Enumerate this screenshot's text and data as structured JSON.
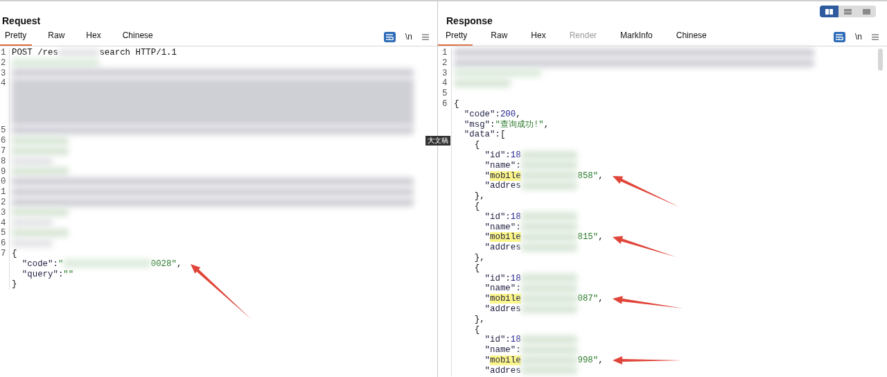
{
  "tooltip": "大文稿",
  "request": {
    "title": "Request",
    "tabs": [
      {
        "label": "Pretty",
        "selected": true,
        "disabled": false
      },
      {
        "label": "Raw",
        "selected": false,
        "disabled": false
      },
      {
        "label": "Hex",
        "selected": false,
        "disabled": false
      },
      {
        "label": "Chinese",
        "selected": false,
        "disabled": false
      }
    ],
    "toolbar": {
      "wrap_on": true,
      "newline_label": "\\n"
    },
    "lines": [
      {
        "num": "1",
        "parts": [
          {
            "kind": "plain",
            "text": "POST /res"
          },
          {
            "kind": "redacted"
          },
          {
            "kind": "plain",
            "text": "search HTTP/1.1"
          }
        ]
      },
      {
        "num": "2",
        "parts": [
          {
            "kind": "redacted"
          }
        ]
      },
      {
        "num": "3",
        "parts": [
          {
            "kind": "redacted"
          }
        ]
      },
      {
        "num": "4",
        "parts": [
          {
            "kind": "redacted_block"
          }
        ]
      },
      {
        "num": "5",
        "parts": [
          {
            "kind": "redacted"
          }
        ]
      },
      {
        "num": "6",
        "parts": [
          {
            "kind": "redacted"
          }
        ]
      },
      {
        "num": "7",
        "parts": [
          {
            "kind": "redacted"
          }
        ]
      },
      {
        "num": "8",
        "parts": [
          {
            "kind": "redacted"
          }
        ]
      },
      {
        "num": "9",
        "parts": [
          {
            "kind": "redacted"
          }
        ]
      },
      {
        "num": "0",
        "parts": [
          {
            "kind": "redacted"
          }
        ]
      },
      {
        "num": "1",
        "parts": [
          {
            "kind": "redacted"
          }
        ]
      },
      {
        "num": "2",
        "parts": [
          {
            "kind": "redacted"
          }
        ]
      },
      {
        "num": "3",
        "parts": [
          {
            "kind": "redacted"
          }
        ]
      },
      {
        "num": "4",
        "parts": [
          {
            "kind": "redacted"
          }
        ]
      },
      {
        "num": "5",
        "parts": [
          {
            "kind": "redacted"
          }
        ]
      },
      {
        "num": "6",
        "parts": [
          {
            "kind": "redacted"
          }
        ]
      },
      {
        "num": "7",
        "parts": [
          {
            "kind": "plain",
            "text": "{"
          }
        ]
      },
      {
        "parts": [
          {
            "kind": "key",
            "text": "  \"code\":"
          },
          {
            "kind": "str",
            "text": "\""
          },
          {
            "kind": "redacted"
          },
          {
            "kind": "str",
            "text": "0028\""
          },
          {
            "kind": "plain",
            "text": ","
          }
        ],
        "annotated": true
      },
      {
        "parts": [
          {
            "kind": "key",
            "text": "  \"query\":"
          },
          {
            "kind": "str",
            "text": "\"\""
          }
        ]
      },
      {
        "parts": [
          {
            "kind": "plain",
            "text": "}"
          }
        ]
      }
    ]
  },
  "response": {
    "title": "Response",
    "layout_buttons": [
      {
        "kind": "columns",
        "selected": true
      },
      {
        "kind": "rows",
        "selected": false
      },
      {
        "kind": "single",
        "selected": false
      }
    ],
    "tabs": [
      {
        "label": "Pretty",
        "selected": true,
        "disabled": false
      },
      {
        "label": "Raw",
        "selected": false,
        "disabled": false
      },
      {
        "label": "Hex",
        "selected": false,
        "disabled": false
      },
      {
        "label": "Render",
        "selected": false,
        "disabled": true
      },
      {
        "label": "MarkInfo",
        "selected": false,
        "disabled": false
      },
      {
        "label": "Chinese",
        "selected": false,
        "disabled": false
      }
    ],
    "toolbar": {
      "wrap_on": true,
      "newline_label": "\\n"
    },
    "lines": [
      {
        "num": "1",
        "parts": [
          {
            "kind": "redacted"
          }
        ]
      },
      {
        "num": "2",
        "parts": [
          {
            "kind": "redacted"
          }
        ]
      },
      {
        "num": "3",
        "parts": [
          {
            "kind": "redacted"
          }
        ]
      },
      {
        "num": "4",
        "parts": [
          {
            "kind": "redacted"
          }
        ]
      },
      {
        "num": "5"
      },
      {
        "num": "6",
        "parts": [
          {
            "kind": "plain",
            "text": "{"
          }
        ]
      },
      {
        "parts": [
          {
            "kind": "key",
            "text": "  \"code\":"
          },
          {
            "kind": "num",
            "text": "200"
          },
          {
            "kind": "plain",
            "text": ","
          }
        ]
      },
      {
        "parts": [
          {
            "kind": "key",
            "text": "  \"msg\":"
          },
          {
            "kind": "str",
            "text": "\"查询成功!\""
          },
          {
            "kind": "plain",
            "text": ","
          }
        ]
      },
      {
        "parts": [
          {
            "kind": "key",
            "text": "  \"data\":"
          },
          {
            "kind": "plain",
            "text": "["
          }
        ]
      },
      {
        "parts": [
          {
            "kind": "plain",
            "text": "    {"
          }
        ]
      },
      {
        "parts": [
          {
            "kind": "key",
            "text": "      \"id\":"
          },
          {
            "kind": "num",
            "text": "18"
          },
          {
            "kind": "redacted"
          }
        ]
      },
      {
        "parts": [
          {
            "kind": "key",
            "text": "      \"name\":"
          },
          {
            "kind": "redacted"
          }
        ]
      },
      {
        "parts": [
          {
            "kind": "key",
            "text": "      \""
          },
          {
            "kind": "mark",
            "text": "mobile"
          },
          {
            "kind": "redacted"
          },
          {
            "kind": "str",
            "text": "858\""
          },
          {
            "kind": "plain",
            "text": ","
          }
        ],
        "annotated": true
      },
      {
        "parts": [
          {
            "kind": "key",
            "text": "      \"addres"
          },
          {
            "kind": "redacted"
          }
        ]
      },
      {
        "parts": [
          {
            "kind": "plain",
            "text": "    },"
          }
        ]
      },
      {
        "parts": [
          {
            "kind": "plain",
            "text": "    {"
          }
        ]
      },
      {
        "parts": [
          {
            "kind": "key",
            "text": "      \"id\":"
          },
          {
            "kind": "num",
            "text": "18"
          },
          {
            "kind": "redacted"
          }
        ]
      },
      {
        "parts": [
          {
            "kind": "key",
            "text": "      \"name\":"
          },
          {
            "kind": "redacted"
          }
        ]
      },
      {
        "parts": [
          {
            "kind": "key",
            "text": "      \""
          },
          {
            "kind": "mark",
            "text": "mobile"
          },
          {
            "kind": "redacted"
          },
          {
            "kind": "str",
            "text": "815\""
          },
          {
            "kind": "plain",
            "text": ","
          }
        ],
        "annotated": true
      },
      {
        "parts": [
          {
            "kind": "key",
            "text": "      \"addres"
          },
          {
            "kind": "redacted"
          }
        ]
      },
      {
        "parts": [
          {
            "kind": "plain",
            "text": "    },"
          }
        ]
      },
      {
        "parts": [
          {
            "kind": "plain",
            "text": "    {"
          }
        ]
      },
      {
        "parts": [
          {
            "kind": "key",
            "text": "      \"id\":"
          },
          {
            "kind": "num",
            "text": "18"
          },
          {
            "kind": "redacted"
          }
        ]
      },
      {
        "parts": [
          {
            "kind": "key",
            "text": "      \"name\":"
          },
          {
            "kind": "redacted"
          }
        ]
      },
      {
        "parts": [
          {
            "kind": "key",
            "text": "      \""
          },
          {
            "kind": "mark",
            "text": "mobile"
          },
          {
            "kind": "redacted"
          },
          {
            "kind": "str",
            "text": "087\""
          },
          {
            "kind": "plain",
            "text": ","
          }
        ],
        "annotated": true
      },
      {
        "parts": [
          {
            "kind": "key",
            "text": "      \"addres"
          },
          {
            "kind": "redacted"
          }
        ]
      },
      {
        "parts": [
          {
            "kind": "plain",
            "text": "    },"
          }
        ]
      },
      {
        "parts": [
          {
            "kind": "plain",
            "text": "    {"
          }
        ]
      },
      {
        "parts": [
          {
            "kind": "key",
            "text": "      \"id\":"
          },
          {
            "kind": "num",
            "text": "18"
          },
          {
            "kind": "redacted"
          }
        ]
      },
      {
        "parts": [
          {
            "kind": "key",
            "text": "      \"name\":"
          },
          {
            "kind": "redacted"
          }
        ]
      },
      {
        "parts": [
          {
            "kind": "key",
            "text": "      \""
          },
          {
            "kind": "mark",
            "text": "mobile"
          },
          {
            "kind": "redacted"
          },
          {
            "kind": "str",
            "text": "998\""
          },
          {
            "kind": "plain",
            "text": ","
          }
        ],
        "annotated": true
      },
      {
        "parts": [
          {
            "kind": "key",
            "text": "      \"addres"
          },
          {
            "kind": "redacted"
          }
        ]
      }
    ]
  }
}
